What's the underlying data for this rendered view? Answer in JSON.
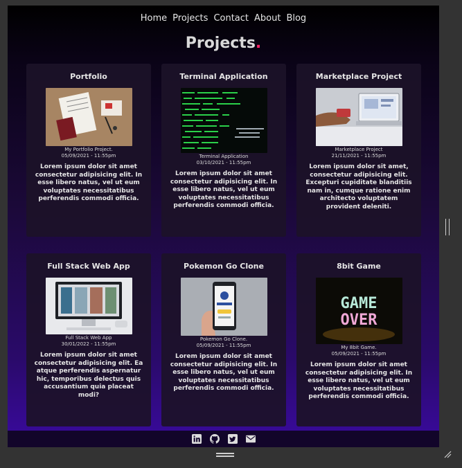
{
  "nav": {
    "items": [
      "Home",
      "Projects",
      "Contact",
      "About",
      "Blog"
    ]
  },
  "page": {
    "title": "Projects",
    "title_dot": ".",
    "accent_color": "#ff2266"
  },
  "projects": [
    {
      "title": "Portfolio",
      "caption_line1": "My Portfolio Project.",
      "caption_line2": "05/09/2021 - 11:55pm",
      "description": "Lorem ipsum dolor sit amet consectetur adipisicing elit. In esse libero natus, vel ut eum voluptates necessitatibus perferendis commodi officia."
    },
    {
      "title": "Terminal Application",
      "caption_line1": "Terminal Application",
      "caption_line2": "03/10/2021 - 11:55pm",
      "description": "Lorem ipsum dolor sit amet consectetur adipisicing elit. In esse libero natus, vel ut eum voluptates necessitatibus perferendis commodi officia."
    },
    {
      "title": "Marketplace Project",
      "caption_line1": "Marketplace Project",
      "caption_line2": "21/11/2021 - 11:55pm",
      "description": "Lorem ipsum dolor sit amet, consectetur adipisicing elit. Excepturi cupiditate blanditiis nam in, cumque ratione enim architecto voluptatem provident deleniti."
    },
    {
      "title": "Full Stack Web App",
      "caption_line1": "Full Stack Web App",
      "caption_line2": "30/01/2022 - 11:55pm",
      "description": "Lorem ipsum dolor sit amet consectetur adipisicing elit. Ea atque perferendis aspernatur hic, temporibus delectus quis accusantium quia placeat modi?"
    },
    {
      "title": "Pokemon Go Clone",
      "caption_line1": "Pokemon Go Clone.",
      "caption_line2": "05/09/2021 - 11:55pm",
      "description": "Lorem ipsum dolor sit amet consectetur adipisicing elit. In esse libero natus, vel ut eum voluptates necessitatibus perferendis commodi officia."
    },
    {
      "title": "8bit Game",
      "caption_line1": "My 8bit Game.",
      "caption_line2": "05/09/2021 - 11:55pm",
      "description": "Lorem ipsum dolor sit amet consectetur adipisicing elit. In esse libero natus, vel ut eum voluptates necessitatibus perferendis commodi officia."
    }
  ],
  "thumbnails": {
    "game_over_text_1": "GAME",
    "game_over_text_2": "OVER"
  },
  "footer": {
    "icons": [
      "linkedin-icon",
      "github-icon",
      "twitter-icon",
      "mail-icon"
    ]
  }
}
